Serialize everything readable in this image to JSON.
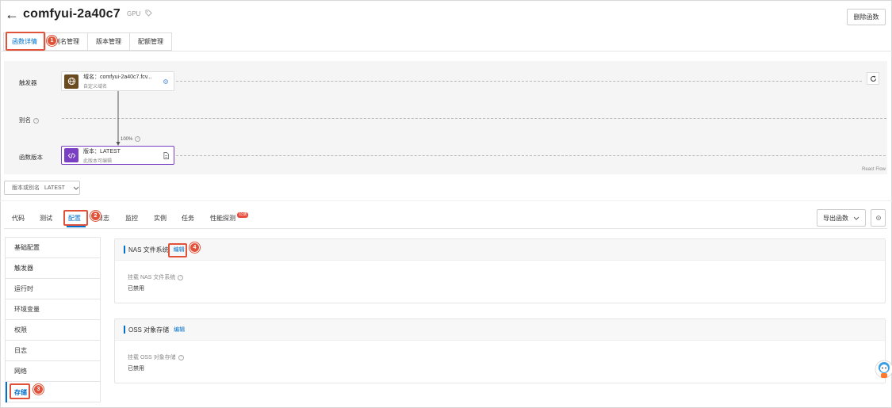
{
  "header": {
    "back_icon": "arrow-left-icon",
    "title": "comfyui-2a40c7",
    "badge": "GPU",
    "delete_label": "删除函数"
  },
  "top_tabs": [
    {
      "label": "函数详情",
      "active": true
    },
    {
      "label": "别名管理",
      "active": false
    },
    {
      "label": "版本管理",
      "active": false
    },
    {
      "label": "配额管理",
      "active": false
    }
  ],
  "flow": {
    "rows": {
      "trigger": "触发器",
      "alias": "别名",
      "version": "函数版本"
    },
    "trigger_node": {
      "title": "域名：comfyui-2a40c7.fcv...",
      "subtitle": "自定义域名"
    },
    "edge_label": "100%",
    "version_node": {
      "title": "版本：LATEST",
      "subtitle": "此版本可编辑"
    },
    "attribution": "React Flow"
  },
  "version_select": {
    "label": "版本或别名",
    "value": "LATEST"
  },
  "sub_tabs": [
    {
      "label": "代码",
      "active": false
    },
    {
      "label": "测试",
      "active": false
    },
    {
      "label": "配置",
      "active": true
    },
    {
      "label": "日志",
      "active": false
    },
    {
      "label": "监控",
      "active": false
    },
    {
      "label": "实例",
      "active": false
    },
    {
      "label": "任务",
      "active": false
    },
    {
      "label": "性能探测",
      "active": false
    }
  ],
  "hot_badge": "公测",
  "export_label": "导出函数",
  "side_menu": [
    {
      "label": "基础配置",
      "active": false
    },
    {
      "label": "触发器",
      "active": false
    },
    {
      "label": "运行时",
      "active": false
    },
    {
      "label": "环境变量",
      "active": false
    },
    {
      "label": "权限",
      "active": false
    },
    {
      "label": "日志",
      "active": false
    },
    {
      "label": "网络",
      "active": false
    },
    {
      "label": "存储",
      "active": true
    }
  ],
  "nas_card": {
    "title": "NAS 文件系统",
    "edit": "编辑",
    "field_label": "挂载 NAS 文件系统",
    "field_value": "已禁用"
  },
  "oss_card": {
    "title": "OSS 对象存储",
    "edit": "编辑",
    "field_label": "挂载 OSS 对象存储",
    "field_value": "已禁用"
  },
  "markers": [
    "1",
    "2",
    "3",
    "4"
  ],
  "colors": {
    "accent": "#0070cc",
    "marker": "#e0533a",
    "trigger_icon": "#6b4a1f",
    "version_icon": "#7b3fc4"
  }
}
